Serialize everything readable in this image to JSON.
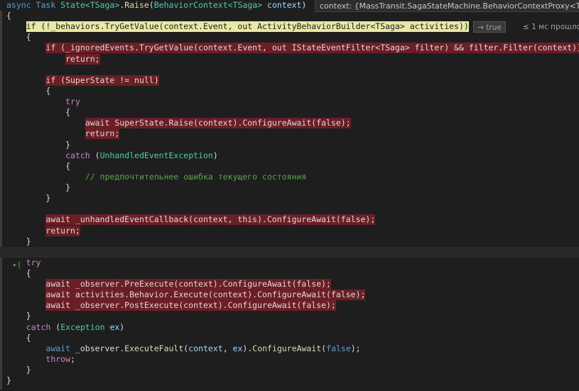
{
  "editor": {
    "lines": [
      [
        {
          "t": "async ",
          "c": "kw"
        },
        {
          "t": "Task ",
          "c": "kw"
        },
        {
          "t": "State<TSaga>",
          "c": "type"
        },
        {
          "t": ".",
          "c": ""
        },
        {
          "t": "Raise",
          "c": "fn"
        },
        {
          "t": "(",
          "c": ""
        },
        {
          "t": "BehaviorContext<TSaga> ",
          "c": "type"
        },
        {
          "t": "context",
          "c": "param"
        },
        {
          "t": ")",
          "c": ""
        }
      ],
      [
        {
          "t": "{",
          "c": ""
        }
      ],
      [
        {
          "t": "    "
        },
        {
          "t": "if (!_behaviors.TryGetValue(context.Event, out ActivityBehaviorBuilder<TSaga> activities))",
          "c": "",
          "hl": "cur"
        }
      ],
      [
        {
          "t": "    {",
          "c": ""
        }
      ],
      [
        {
          "t": "        "
        },
        {
          "t": "if (_ignoredEvents.TryGetValue(context.Event, out IStateEventFilter<TSaga> filter) && filter.Filter(context))",
          "hl": "bp"
        }
      ],
      [
        {
          "t": "            "
        },
        {
          "t": "return;",
          "hl": "bp"
        }
      ],
      [
        {
          "t": ""
        }
      ],
      [
        {
          "t": "        "
        },
        {
          "t": "if (SuperState != null)",
          "hl": "bp"
        }
      ],
      [
        {
          "t": "        {"
        }
      ],
      [
        {
          "t": "            "
        },
        {
          "t": "try",
          "c": "kw2"
        }
      ],
      [
        {
          "t": "            {"
        }
      ],
      [
        {
          "t": "                "
        },
        {
          "t": "await SuperState.Raise(context).ConfigureAwait(false);",
          "hl": "bp"
        }
      ],
      [
        {
          "t": "                "
        },
        {
          "t": "return;",
          "hl": "bp"
        }
      ],
      [
        {
          "t": "            }"
        }
      ],
      [
        {
          "t": "            "
        },
        {
          "t": "catch ",
          "c": "kw2"
        },
        {
          "t": "("
        },
        {
          "t": "UnhandledEventException",
          "c": "type"
        },
        {
          "t": ")"
        }
      ],
      [
        {
          "t": "            {"
        }
      ],
      [
        {
          "t": "                "
        },
        {
          "t": "// предпочтительнее ошибка текущего состояния",
          "c": "cmt"
        }
      ],
      [
        {
          "t": "            }"
        }
      ],
      [
        {
          "t": "        }"
        }
      ],
      [
        {
          "t": ""
        }
      ],
      [
        {
          "t": "        "
        },
        {
          "t": "await _unhandledEventCallback(context, this).ConfigureAwait(false);",
          "hl": "bp"
        }
      ],
      [
        {
          "t": "        "
        },
        {
          "t": "return;",
          "hl": "bp"
        }
      ],
      [
        {
          "t": "    }"
        }
      ],
      [
        {
          "t": ""
        }
      ],
      [
        {
          "t": "    "
        },
        {
          "t": "try",
          "c": "kw2"
        }
      ],
      [
        {
          "t": "    {"
        }
      ],
      [
        {
          "t": "        "
        },
        {
          "t": "await _observer.PreExecute(context).ConfigureAwait(false);",
          "hl": "bp"
        }
      ],
      [
        {
          "t": "        "
        },
        {
          "t": "await activities.Behavior.Execute(context).ConfigureAwait(false);",
          "hl": "bp"
        }
      ],
      [
        {
          "t": "        "
        },
        {
          "t": "await _observer.PostExecute(context).ConfigureAwait(false);",
          "hl": "bp"
        }
      ],
      [
        {
          "t": "    }"
        }
      ],
      [
        {
          "t": "    "
        },
        {
          "t": "catch ",
          "c": "kw2"
        },
        {
          "t": "("
        },
        {
          "t": "Exception ",
          "c": "type"
        },
        {
          "t": "ex",
          "c": "param"
        },
        {
          "t": ")"
        }
      ],
      [
        {
          "t": "    {"
        }
      ],
      [
        {
          "t": "        "
        },
        {
          "t": "await ",
          "c": "kw"
        },
        {
          "t": "_observer",
          "c": ""
        },
        {
          "t": "."
        },
        {
          "t": "ExecuteFault",
          "c": "fn"
        },
        {
          "t": "("
        },
        {
          "t": "context",
          "c": "param"
        },
        {
          "t": ", "
        },
        {
          "t": "ex",
          "c": "param"
        },
        {
          "t": ")."
        },
        {
          "t": "ConfigureAwait",
          "c": "fn"
        },
        {
          "t": "("
        },
        {
          "t": "false",
          "c": "kw"
        },
        {
          "t": ");"
        }
      ],
      [
        {
          "t": "        "
        },
        {
          "t": "throw",
          "c": "kw2"
        },
        {
          "t": ";"
        }
      ],
      [
        {
          "t": "    }"
        }
      ],
      [
        {
          "t": "}"
        }
      ]
    ]
  },
  "datatip": {
    "text": "context: {MassTransit.SagaStateMachine.BehaviorContextProxy<Test..."
  },
  "perf": {
    "result": "→ true",
    "elapsed": "≤ 1 мс прошло"
  },
  "marker": {
    "step_icon": "▸|"
  }
}
